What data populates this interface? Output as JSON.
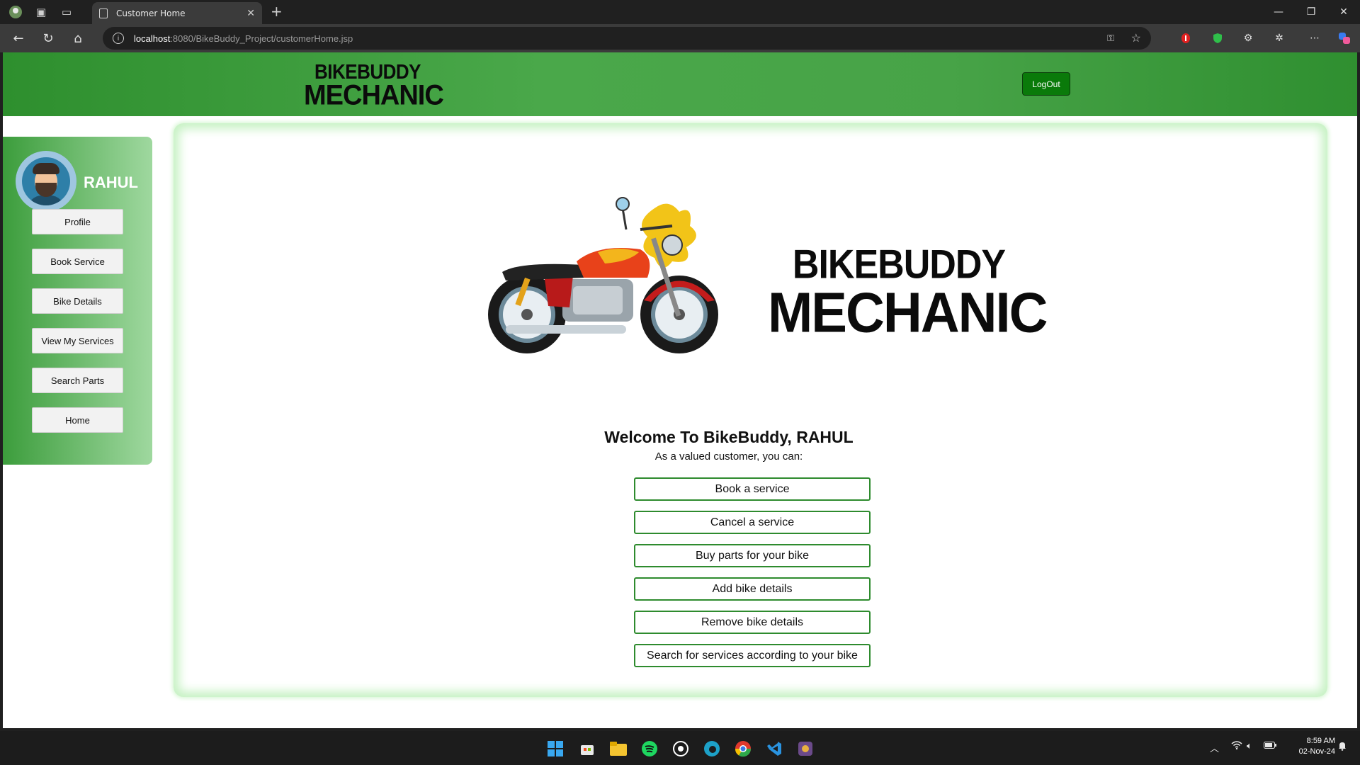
{
  "browser": {
    "tab_title": "Customer Home",
    "url_host": "localhost",
    "url_rest": ":8080/BikeBuddy_Project/customerHome.jsp"
  },
  "header": {
    "logo_line1": "BIKEBUDDY",
    "logo_line2": "MECHANIC",
    "logout_label": "LogOut"
  },
  "sidebar": {
    "username": "RAHUL",
    "items": [
      {
        "label": "Profile"
      },
      {
        "label": "Book Service"
      },
      {
        "label": "Bike Details"
      },
      {
        "label": "View My Services"
      },
      {
        "label": "Search Parts"
      },
      {
        "label": "Home"
      }
    ]
  },
  "main": {
    "logo_line1": "BIKEBUDDY",
    "logo_line2": "MECHANIC",
    "welcome": "Welcome To BikeBuddy, RAHUL",
    "subtitle": "As a valued customer, you can:",
    "features": [
      {
        "label": "Book a service"
      },
      {
        "label": "Cancel a service"
      },
      {
        "label": "Buy parts for your bike"
      },
      {
        "label": "Add bike details"
      },
      {
        "label": "Remove bike details"
      },
      {
        "label": "Search for services according to your bike"
      }
    ]
  },
  "taskbar": {
    "time": "8:59 AM",
    "date": "02-Nov-24"
  },
  "colors": {
    "header_green": "#47a347",
    "button_green": "#0a7a0a",
    "feature_border": "#2e8b2e"
  }
}
